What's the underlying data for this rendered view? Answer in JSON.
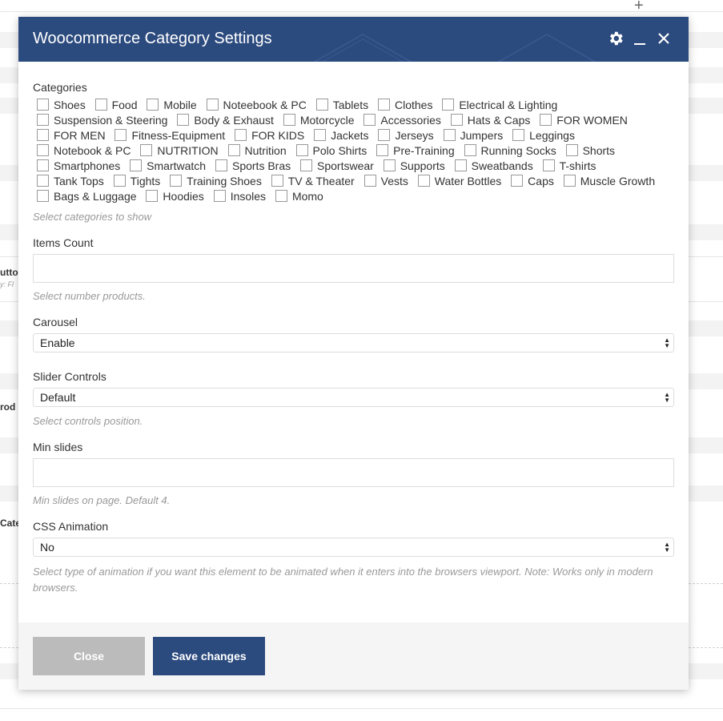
{
  "modal": {
    "title": "Woocommerce Category Settings"
  },
  "background": {
    "label_1": "utto",
    "sub_1": "y: Fl",
    "label_2": "rod",
    "label_3": "Cate"
  },
  "categories": {
    "label": "Categories",
    "items": [
      "Shoes",
      "Food",
      "Mobile",
      "Noteebook & PC",
      "Tablets",
      "Clothes",
      "Electrical & Lighting",
      "Suspension & Steering",
      "Body & Exhaust",
      "Motorcycle",
      "Accessories",
      "Hats & Caps",
      "FOR WOMEN",
      "FOR MEN",
      "Fitness-Equipment",
      "FOR KIDS",
      "Jackets",
      "Jerseys",
      "Jumpers",
      "Leggings",
      "Notebook & PC",
      "NUTRITION",
      "Nutrition",
      "Polo Shirts",
      "Pre-Training",
      "Running Socks",
      "Shorts",
      "Smartphones",
      "Smartwatch",
      "Sports Bras",
      "Sportswear",
      "Supports",
      "Sweatbands",
      "T-shirts",
      "Tank Tops",
      "Tights",
      "Training Shoes",
      "TV & Theater",
      "Vests",
      "Water Bottles",
      "Caps",
      "Muscle Growth",
      "Bags & Luggage",
      "Hoodies",
      "Insoles",
      "Momo"
    ],
    "help": "Select categories to show"
  },
  "items_count": {
    "label": "Items Count",
    "value": "",
    "help": "Select number products."
  },
  "carousel": {
    "label": "Carousel",
    "value": "Enable"
  },
  "slider_controls": {
    "label": "Slider Controls",
    "value": "Default",
    "help": "Select controls position."
  },
  "min_slides": {
    "label": "Min slides",
    "value": "",
    "help": "Min slides on page. Default 4."
  },
  "css_animation": {
    "label": "CSS Animation",
    "value": "No",
    "help": "Select type of animation if you want this element to be animated when it enters into the browsers viewport. Note: Works only in modern browsers."
  },
  "footer": {
    "close_label": "Close",
    "save_label": "Save changes"
  },
  "colors": {
    "header_bg": "#2b4a7e",
    "save_bg": "#2b4a7e",
    "close_bg": "#bbbbbb"
  },
  "icons": [
    "gear-icon",
    "minimize-icon",
    "close-icon",
    "plus-icon",
    "select-arrows-icon"
  ]
}
